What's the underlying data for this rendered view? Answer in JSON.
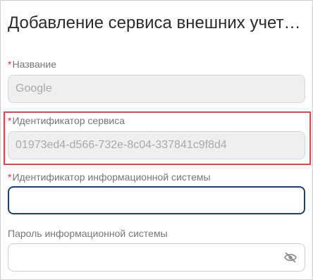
{
  "dialog": {
    "title": "Добавление сервиса внешних учет…"
  },
  "fields": {
    "name": {
      "required_mark": "*",
      "label": "Название",
      "value": "Google"
    },
    "service_id": {
      "required_mark": "*",
      "label": "Идентификатор сервиса",
      "value": "01973ed4-d566-732e-8c04-337841c9f8d4"
    },
    "is_id": {
      "required_mark": "*",
      "label": "Идентификатор информационной системы",
      "value": ""
    },
    "is_password": {
      "label": "Пароль информационной системы",
      "value": "",
      "toggle_icon": "eye-off-icon"
    }
  },
  "colors": {
    "required": "#d9363e",
    "highlight": "#e0474c",
    "focus_border": "#1c3f72",
    "disabled_bg": "#efefef"
  }
}
